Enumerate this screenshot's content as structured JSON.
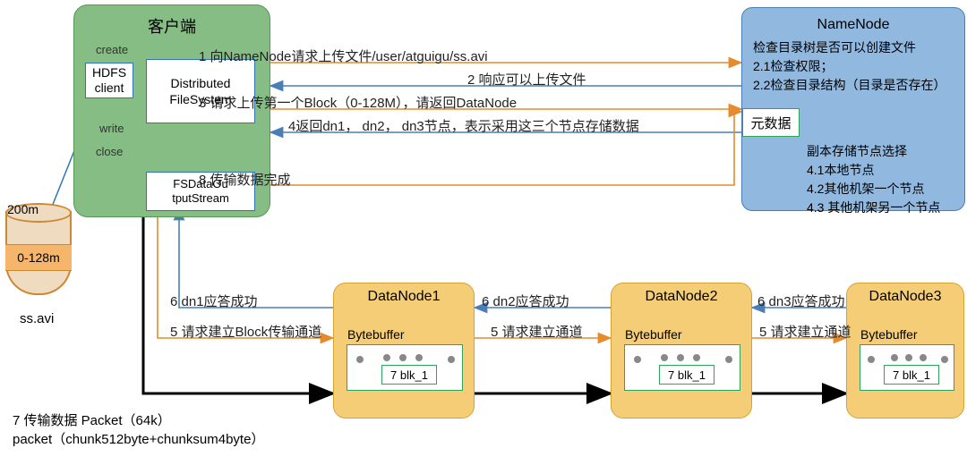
{
  "client": {
    "title": "客户端",
    "create": "create",
    "write": "write",
    "close": "close",
    "hdfs": "HDFS client",
    "dfs": "Distributed FileSystem",
    "fsout": "FSDataOu tputStream"
  },
  "disk": {
    "top": "200m",
    "band": "0-128m",
    "name": "ss.avi"
  },
  "namenode": {
    "title": "NameNode",
    "l1": "检查目录树是否可以创建文件",
    "l2": "2.1检查权限；",
    "l3": "2.2检查目录结构（目录是否存在）",
    "meta": "元数据",
    "r1": "副本存储节点选择",
    "r2": "4.1本地节点",
    "r3": "4.2其他机架一个节点",
    "r4": "4.3 其他机架另一个节点"
  },
  "dn": {
    "t1": "DataNode1",
    "t2": "DataNode2",
    "t3": "DataNode3",
    "bb": "Bytebuffer",
    "blk": "7 blk_1"
  },
  "msg": {
    "m1": "1 向NameNode请求上传文件/user/atguigu/ss.avi",
    "m2": "2 响应可以上传文件",
    "m3": "3 请求上传第一个Block（0-128M），请返回DataNode",
    "m4": "4返回dn1， dn2， dn3节点，表示采用这三个节点存储数据",
    "m5a": "5 请求建立Block传输通道",
    "m5b": "5 请求建立通道",
    "m5c": "5 请求建立通道",
    "m6a": "6 dn1应答成功",
    "m6b": "6 dn2应答成功",
    "m6c": "6 dn3应答成功",
    "m7": "7 传输数据  Packet（64k）",
    "m7b": "packet（chunk512byte+chunksum4byte）",
    "m8": "8 传输数据完成"
  }
}
